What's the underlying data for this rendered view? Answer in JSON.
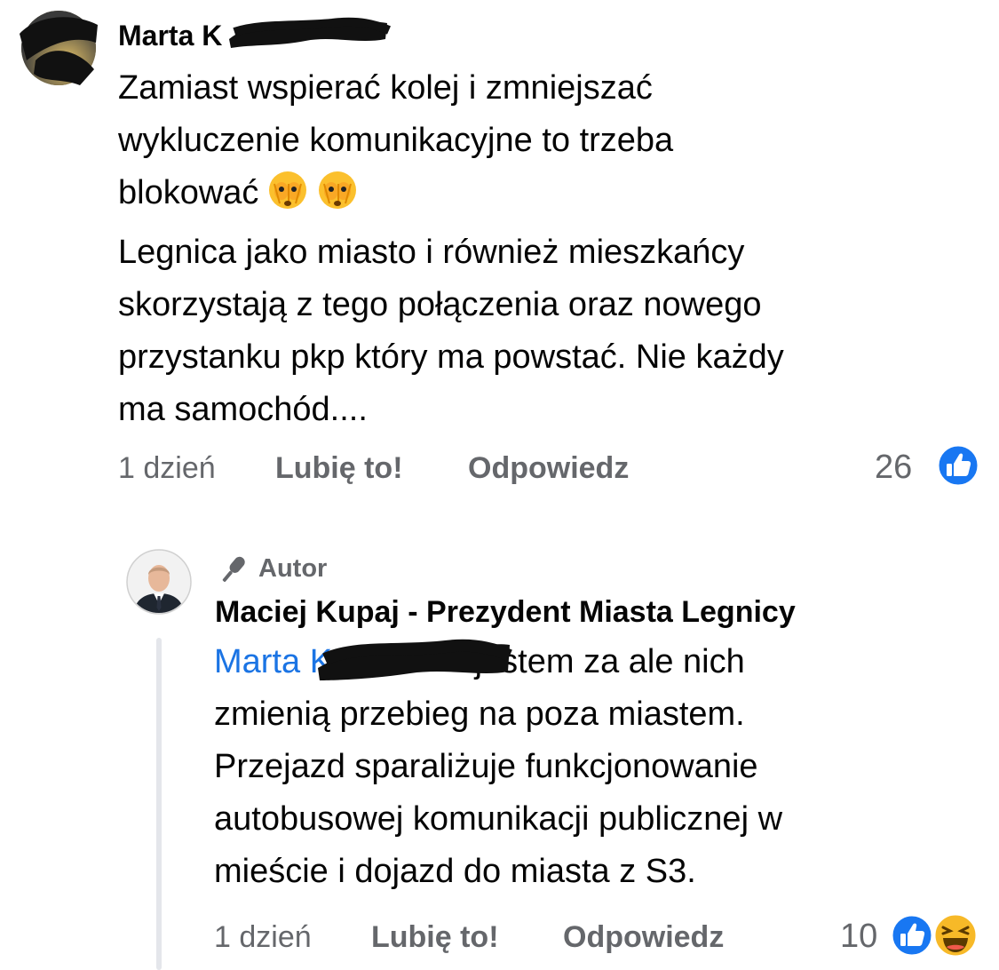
{
  "comment": {
    "author": "Marta K",
    "body_lines": [
      "Zamiast  wspierać kolej i zmniejszać",
      "wykluczenie komunikacyjne to trzeba",
      "blokować",
      "Legnica jako miasto i również mieszkańcy",
      "skorzystają z tego połączenia oraz nowego",
      "przystanku pkp który ma powstać. Nie każdy",
      "ma samochód...."
    ],
    "emoji": [
      "see-no-evil-face-icon",
      "see-no-evil-face-icon"
    ],
    "time": "1 dzień",
    "like_label": "Lubię to!",
    "reply_label": "Odpowiedz",
    "reaction_count": "26",
    "reaction_types": [
      "like-icon"
    ]
  },
  "reply": {
    "badge": "Autor",
    "author": "Maciej Kupaj - Prezydent Miasta Legnicy",
    "mention": "Marta K",
    "body_lines": [
      "jestem za ale nich",
      "zmienią przebieg na poza miastem.",
      "Przejazd sparaliżuje funkcjonowanie",
      "autobusowej komunikacji publicznej w",
      "mieście i dojazd do miasta z S3."
    ],
    "time": "1 dzień",
    "like_label": "Lubię to!",
    "reply_label": "Odpowiedz",
    "reaction_count": "10",
    "reaction_types": [
      "like-icon",
      "haha-icon"
    ]
  },
  "colors": {
    "text": "#050505",
    "meta": "#65676b",
    "mention": "#1b74e4",
    "like_blue": "#1877f2",
    "haha_yellow": "#f7b928"
  }
}
